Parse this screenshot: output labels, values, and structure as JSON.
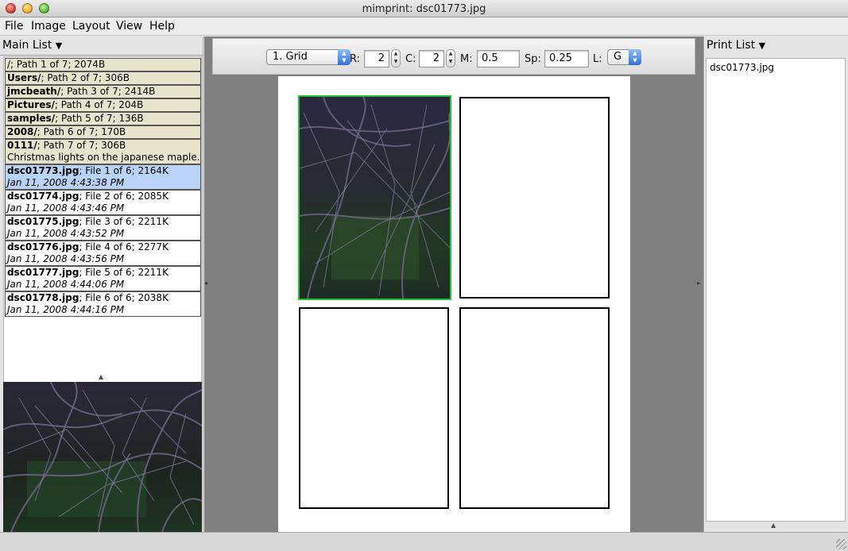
{
  "window": {
    "title": "mimprint: dsc01773.jpg"
  },
  "menubar": {
    "items": [
      "File",
      "Image",
      "Layout",
      "View",
      "Help"
    ]
  },
  "main_list": {
    "header": "Main List",
    "header_arrow": "▼",
    "paths": [
      {
        "name": "/",
        "info": "; Path 1 of 7; 2074B"
      },
      {
        "name": "Users/",
        "info": "; Path 2 of 7; 306B"
      },
      {
        "name": "jmcbeath/",
        "info": "; Path 3 of 7; 2414B"
      },
      {
        "name": "Pictures/",
        "info": "; Path 4 of 7; 204B"
      },
      {
        "name": "samples/",
        "info": "; Path 5 of 7; 136B"
      },
      {
        "name": "2008/",
        "info": "; Path 6 of 7; 170B"
      },
      {
        "name": "0111/",
        "info": "; Path 7 of 7; 306B",
        "note": "Christmas lights on the japanese maple."
      }
    ],
    "files": [
      {
        "name": "dsc01773.jpg",
        "info": "; File 1 of 6; 2164K",
        "date": "Jan 11, 2008 4:43:38 PM",
        "selected": true
      },
      {
        "name": "dsc01774.jpg",
        "info": "; File 2 of 6; 2085K",
        "date": "Jan 11, 2008 4:43:46 PM",
        "selected": false
      },
      {
        "name": "dsc01775.jpg",
        "info": "; File 3 of 6; 2211K",
        "date": "Jan 11, 2008 4:43:52 PM",
        "selected": false
      },
      {
        "name": "dsc01776.jpg",
        "info": "; File 4 of 6; 2277K",
        "date": "Jan 11, 2008 4:43:56 PM",
        "selected": false
      },
      {
        "name": "dsc01777.jpg",
        "info": "; File 5 of 6; 2211K",
        "date": "Jan 11, 2008 4:44:06 PM",
        "selected": false
      },
      {
        "name": "dsc01778.jpg",
        "info": "; File 6 of 6; 2038K",
        "date": "Jan 11, 2008 4:44:16 PM",
        "selected": false
      }
    ]
  },
  "toolbar": {
    "layout_select": "1. Grid",
    "r_label": "R:",
    "r_value": "2",
    "c_label": "C:",
    "c_value": "2",
    "m_label": "M:",
    "m_value": "0.5",
    "sp_label": "Sp:",
    "sp_value": "0.25",
    "l_label": "L:",
    "l_select": "G"
  },
  "print_list": {
    "header": "Print List",
    "header_arrow": "▼",
    "items": [
      "dsc01773.jpg"
    ]
  },
  "colors": {
    "selected_row": "#b9d3f6",
    "path_row": "#e7e4cd",
    "active_cell_border": "#22c036",
    "center_background": "#808080"
  }
}
